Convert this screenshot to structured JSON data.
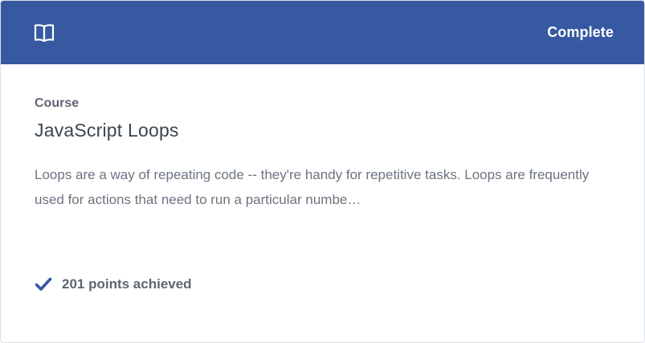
{
  "header": {
    "icon": "book-icon",
    "status": "Complete",
    "background": "#3659a2"
  },
  "course": {
    "type": "Course",
    "title": "JavaScript Loops",
    "description": "Loops are a way of repeating code -- they're handy for repetitive tasks. Loops are frequently used for actions that need to run a particular numbe…"
  },
  "footer": {
    "icon": "checkmark-icon",
    "points": "201 points achieved",
    "accent": "#3659a2"
  }
}
